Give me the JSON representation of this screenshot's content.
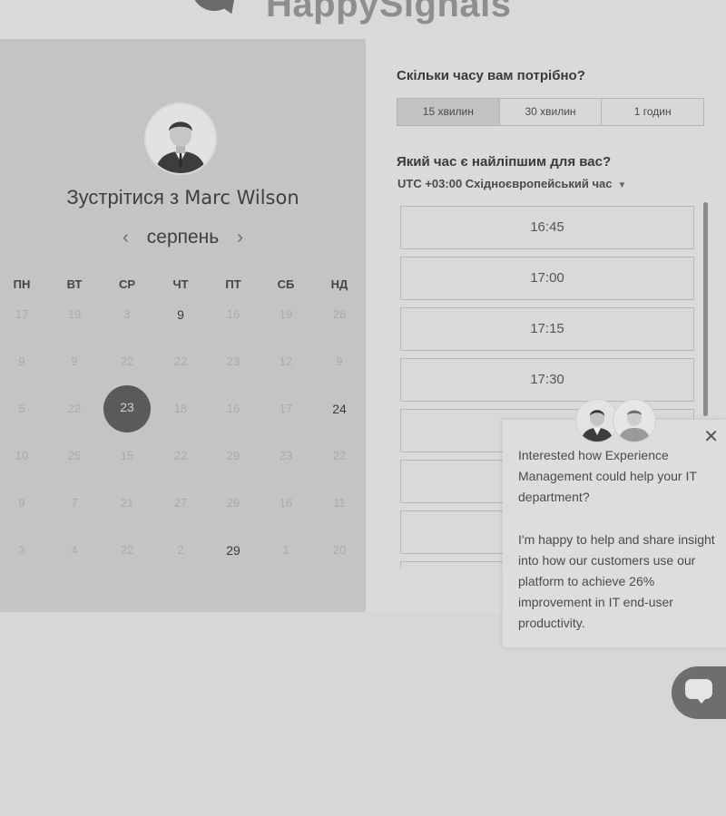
{
  "header": {
    "logo_text": "HappySignals"
  },
  "host": {
    "avatar_icon": "person-avatar-icon"
  },
  "meeting": {
    "prefix": "Зустрітися з ",
    "host_name": "Marc Wilson"
  },
  "calendar": {
    "month": "серпень",
    "prev_icon": "chevron-left-icon",
    "next_icon": "chevron-right-icon",
    "weekdays": [
      "ПН",
      "ВТ",
      "СР",
      "ЧТ",
      "ПТ",
      "СБ",
      "НД"
    ],
    "weeks": [
      [
        "17",
        "19",
        "3",
        "9",
        "16",
        "19",
        "28"
      ],
      [
        "9",
        "9",
        "22",
        "22",
        "23",
        "12",
        "9"
      ],
      [
        "5",
        "22",
        "23",
        "18",
        "16",
        "17",
        "24"
      ],
      [
        "10",
        "25",
        "15",
        "22",
        "29",
        "23",
        "22"
      ],
      [
        "9",
        "7",
        "21",
        "27",
        "29",
        "16",
        "11"
      ],
      [
        "3",
        "4",
        "22",
        "2",
        "29",
        "1",
        "20"
      ]
    ],
    "selected": {
      "week": 2,
      "day": 2,
      "label": "23"
    },
    "available": [
      [
        0,
        3
      ],
      [
        2,
        6
      ],
      [
        5,
        4
      ]
    ]
  },
  "duration": {
    "question": "Скільки часу вам потрібно?",
    "options": [
      "15 хвилин",
      "30 хвилин",
      "1 годин"
    ],
    "selected_index": 0
  },
  "times": {
    "question": "Який час є найліпшим для вас?",
    "timezone": "UTC +03:00 Східноєвропейський час",
    "slots": [
      "16:45",
      "17:00",
      "17:15",
      "17:30",
      "",
      "",
      "",
      ""
    ]
  },
  "chat": {
    "message_1": "Interested how Experience Management could help your IT department?",
    "message_2": "I'm happy to help and share insight into how our customers use our platform to achieve 26% improvement in IT end-user productivity.",
    "close_icon": "close-icon",
    "launcher_icon": "chat-bubble-icon"
  },
  "colors": {
    "selected_day": "#5a5a5a",
    "left_panel": "#c4c4c4",
    "right_panel": "#dadada"
  }
}
